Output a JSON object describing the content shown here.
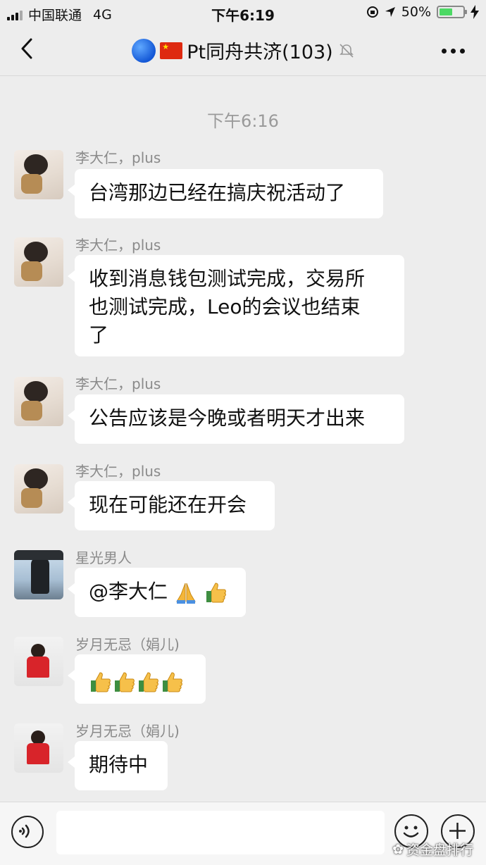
{
  "status_bar": {
    "carrier": "中国联通",
    "network": "4G",
    "time": "下午6:19",
    "battery": "50%",
    "battery_level": 0.5
  },
  "nav": {
    "title": "Pt同舟共济(103)",
    "icons": [
      "back-icon",
      "globe-icon",
      "china-flag-icon",
      "mute-icon",
      "more-icon"
    ]
  },
  "chat": {
    "timestamp": "下午6:16",
    "messages": [
      {
        "sender": "李大仁，plus",
        "text": "台湾那边已经在搞庆祝活动了",
        "avatar": "baby-avatar"
      },
      {
        "sender": "李大仁，plus",
        "text_lines": [
          "收到消息钱包测试完成，交易所",
          "也测试完成，Leo的会议也结束",
          "了"
        ],
        "avatar": "baby-avatar"
      },
      {
        "sender": "李大仁，plus",
        "text": "公告应该是今晚或者明天才出来",
        "avatar": "baby-avatar"
      },
      {
        "sender": "李大仁，plus",
        "text": "现在可能还在开会",
        "avatar": "baby-avatar"
      },
      {
        "sender": "星光男人",
        "text": "@李大仁",
        "emojis": [
          "pray-emoji",
          "thumbs-up-emoji"
        ],
        "avatar": "man-avatar"
      },
      {
        "sender": "岁月无忌（娟儿)",
        "text": "",
        "emojis": [
          "thumbs-up-emoji",
          "thumbs-up-emoji",
          "thumbs-up-emoji",
          "thumbs-up-emoji"
        ],
        "avatar": "woman-avatar"
      },
      {
        "sender": "岁月无忌（娟儿)",
        "text": "期待中",
        "avatar": "woman-avatar"
      }
    ]
  },
  "input_bar": {
    "icons": [
      "voice-icon",
      "emoji-icon",
      "plus-icon"
    ]
  },
  "watermark": "资金盘排行",
  "colors": {
    "background": "#ededed",
    "bubble": "#ffffff",
    "battery_fill": "#4cd964"
  }
}
